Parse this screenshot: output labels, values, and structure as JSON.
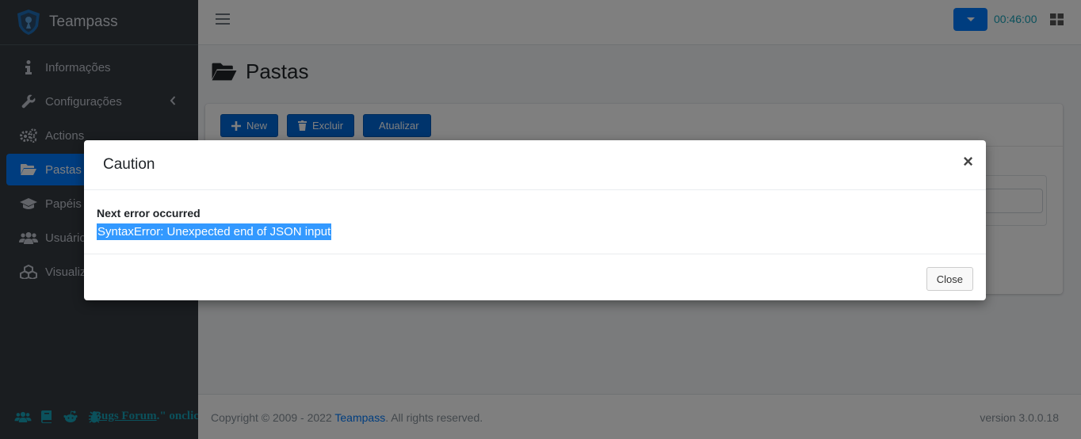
{
  "app": {
    "brand": "Teampass"
  },
  "sidebar": {
    "items": [
      {
        "label": "Informações",
        "icon": "info-icon"
      },
      {
        "label": "Configurações",
        "icon": "wrench-icon"
      },
      {
        "label": "Actions",
        "icon": "cogs-icon"
      },
      {
        "label": "Pastas",
        "icon": "folder-open-icon",
        "active": true
      },
      {
        "label": "Papéis",
        "icon": "graduation-cap-icon"
      },
      {
        "label": "Usuários",
        "icon": "users-icon"
      },
      {
        "label": "Visualizar",
        "icon": "cubes-icon"
      }
    ],
    "footer": {
      "bug_prefix": "Bugs Forum",
      "bug_suffix": ".\" onclick=\"generateBugReport()\">"
    }
  },
  "topbar": {
    "timer": "00:46:00"
  },
  "page": {
    "title": "Pastas",
    "toolbar": {
      "new_label": "New",
      "delete_label": "Excluir",
      "refresh_label": "Atualizar"
    }
  },
  "footer": {
    "copyright_prefix": "Copyright © 2009 - 2022 ",
    "copyright_link": "Teampass",
    "copyright_suffix": ". All rights reserved.",
    "version": "version 3.0.0.18"
  },
  "modal": {
    "title": "Caution",
    "close_symbol": "×",
    "error_heading": "Next error occurred",
    "error_message": "SyntaxError: Unexpected end of JSON input",
    "close_label": "Close"
  },
  "colors": {
    "primary": "#007bff",
    "sidebar_bg": "#343a40",
    "selection": "#3399ff",
    "accent": "#17a2b8"
  }
}
